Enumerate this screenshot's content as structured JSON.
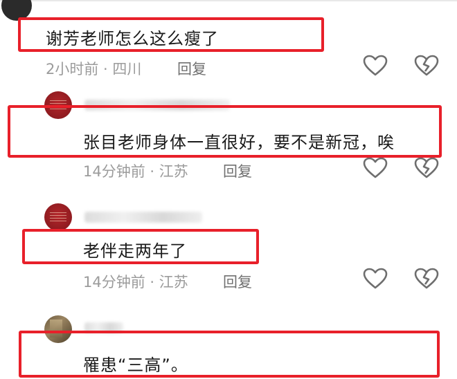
{
  "comments": [
    {
      "text": "谢芳老师怎么这么瘦了",
      "time_location": "2小时前 · 四川",
      "reply_label": "回复"
    },
    {
      "text": "张目老师身体一直很好，要不是新冠，唉",
      "time_location": "14分钟前 · 江苏",
      "reply_label": "回复"
    },
    {
      "text": "老伴走两年了",
      "time_location": "14分钟前 · 江苏",
      "reply_label": "回复"
    },
    {
      "text": "罹患“三高”。"
    }
  ],
  "icons": {
    "like": "heart-outline-icon",
    "dislike": "broken-heart-icon"
  },
  "colors": {
    "highlight": "#e8202a",
    "meta_text": "#9b9b9b",
    "icon_stroke": "#6e6e6e"
  }
}
